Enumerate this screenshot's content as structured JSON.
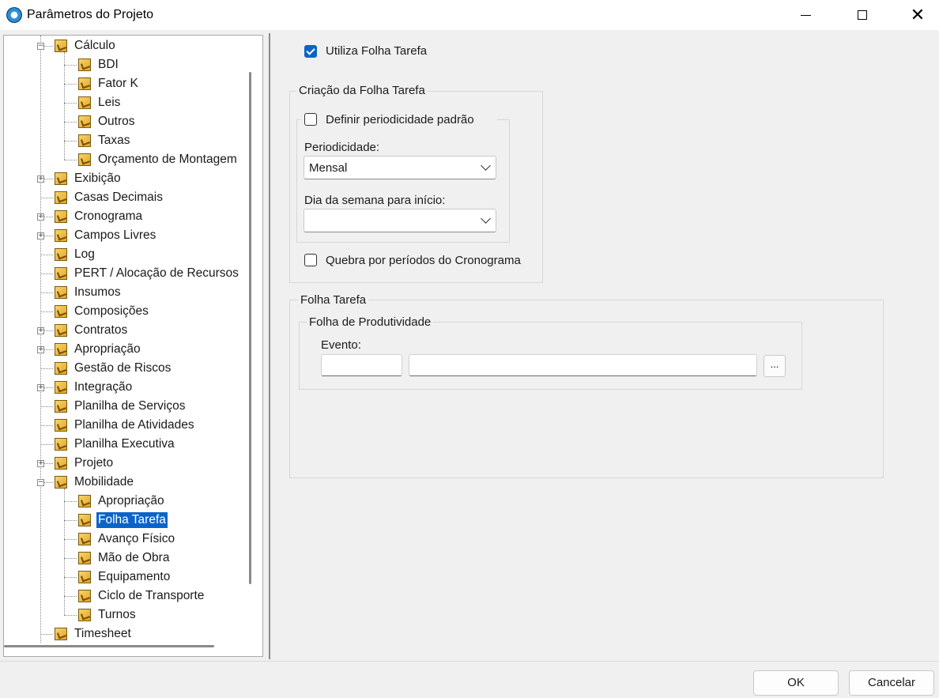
{
  "window": {
    "title": "Parâmetros do Projeto"
  },
  "tree": {
    "items": [
      {
        "label": "Cálculo",
        "level": 1,
        "expander": "minus"
      },
      {
        "label": "BDI",
        "level": 2
      },
      {
        "label": "Fator K",
        "level": 2
      },
      {
        "label": "Leis",
        "level": 2
      },
      {
        "label": "Outros",
        "level": 2
      },
      {
        "label": "Taxas",
        "level": 2
      },
      {
        "label": "Orçamento de Montagem",
        "level": 2
      },
      {
        "label": "Exibição",
        "level": 1,
        "expander": "plus"
      },
      {
        "label": "Casas Decimais",
        "level": 1
      },
      {
        "label": "Cronograma",
        "level": 1,
        "expander": "plus"
      },
      {
        "label": "Campos Livres",
        "level": 1,
        "expander": "plus"
      },
      {
        "label": "Log",
        "level": 1
      },
      {
        "label": "PERT / Alocação de Recursos",
        "level": 1
      },
      {
        "label": "Insumos",
        "level": 1
      },
      {
        "label": "Composições",
        "level": 1
      },
      {
        "label": "Contratos",
        "level": 1,
        "expander": "plus"
      },
      {
        "label": "Apropriação",
        "level": 1,
        "expander": "plus"
      },
      {
        "label": "Gestão de Riscos",
        "level": 1
      },
      {
        "label": "Integração",
        "level": 1,
        "expander": "plus"
      },
      {
        "label": "Planilha de Serviços",
        "level": 1
      },
      {
        "label": "Planilha de Atividades",
        "level": 1
      },
      {
        "label": "Planilha Executiva",
        "level": 1
      },
      {
        "label": "Projeto",
        "level": 1,
        "expander": "plus"
      },
      {
        "label": "Mobilidade",
        "level": 1,
        "expander": "minus"
      },
      {
        "label": "Apropriação",
        "level": 2
      },
      {
        "label": "Folha Tarefa",
        "level": 2,
        "selected": true
      },
      {
        "label": "Avanço Físico",
        "level": 2
      },
      {
        "label": "Mão de Obra",
        "level": 2
      },
      {
        "label": "Equipamento",
        "level": 2
      },
      {
        "label": "Ciclo de Transporte",
        "level": 2
      },
      {
        "label": "Turnos",
        "level": 2
      },
      {
        "label": "Timesheet",
        "level": 1
      }
    ]
  },
  "form": {
    "utiliza_folha_tarefa": {
      "label": "Utiliza Folha Tarefa",
      "checked": true
    },
    "criacao_group": {
      "legend": "Criação da Folha Tarefa"
    },
    "definir_periodicidade": {
      "label": "Definir periodicidade padrão",
      "checked": false
    },
    "periodicidade": {
      "label": "Periodicidade:",
      "value": "Mensal"
    },
    "dia_semana": {
      "label": "Dia da semana para início:",
      "value": ""
    },
    "quebra_periodos": {
      "label": "Quebra por períodos do Cronograma",
      "checked": false
    },
    "folha_tarefa_group": {
      "legend": "Folha Tarefa"
    },
    "folha_produtividade_group": {
      "legend": "Folha de Produtividade"
    },
    "evento": {
      "label": "Evento:",
      "code": "",
      "description": "",
      "browse_label": "..."
    }
  },
  "buttons": {
    "ok": "OK",
    "cancel": "Cancelar"
  },
  "colors": {
    "selection": "#0a64c8",
    "accent": "#0a64c8"
  }
}
